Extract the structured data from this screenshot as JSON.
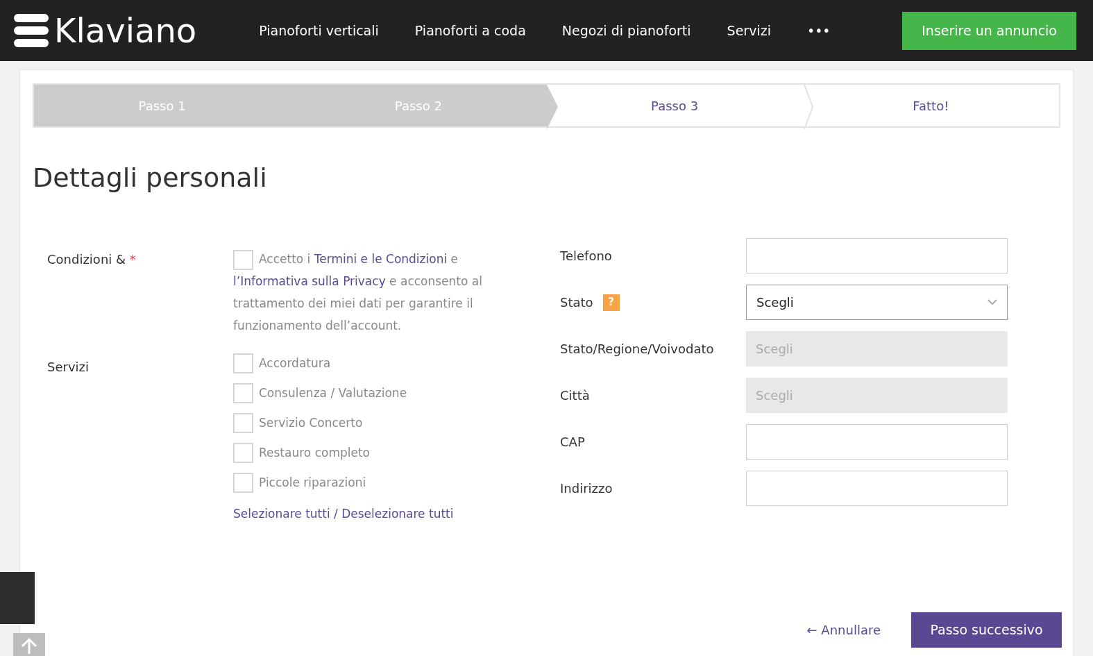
{
  "header": {
    "logo": "Klaviano",
    "nav": [
      "Pianoforti verticali",
      "Pianoforti a coda",
      "Negozi di pianoforti",
      "Servizi",
      "•••"
    ],
    "cta": "Inserire un annuncio"
  },
  "steps": [
    {
      "label": "Passo 1",
      "done": true
    },
    {
      "label": "Passo 2",
      "done": true
    },
    {
      "label": "Passo 3",
      "done": false
    },
    {
      "label": "Fatto!",
      "done": false
    }
  ],
  "title": "Dettagli personali",
  "terms": {
    "label": "Condizioni &",
    "required_mark": "*",
    "checked": false,
    "segments": [
      {
        "kind": "text",
        "text": "Accetto i "
      },
      {
        "kind": "link",
        "text": "Termini e le Condizioni"
      },
      {
        "kind": "text",
        "text": " e "
      },
      {
        "kind": "link",
        "text": "l’Informativa sulla Privacy"
      },
      {
        "kind": "text",
        "text": " e acconsento al trattamento dei miei dati per garantire il funzionamento dell’account."
      }
    ]
  },
  "services": {
    "label": "Servizi",
    "options": [
      {
        "label": "Accordatura",
        "checked": false
      },
      {
        "label": "Consulenza / Valutazione",
        "checked": false
      },
      {
        "label": "Servizio Concerto",
        "checked": false
      },
      {
        "label": "Restauro completo",
        "checked": false
      },
      {
        "label": "Piccole riparazioni",
        "checked": false
      }
    ],
    "select_all": "Selezionare tutti",
    "separator": "/",
    "deselect_all": "Deselezionare tutti"
  },
  "fields": [
    {
      "label": "Telefono",
      "kind": "text"
    },
    {
      "label": "Stato",
      "kind": "select",
      "help": "?",
      "value": "Scegli"
    },
    {
      "label": "Stato/Regione/Voivodato",
      "kind": "select",
      "disabled": true,
      "value": "Scegli"
    },
    {
      "label": "Città",
      "kind": "select",
      "disabled": true,
      "value": "Scegli"
    },
    {
      "label": "CAP",
      "kind": "text"
    },
    {
      "label": "Indirizzo",
      "kind": "text"
    }
  ],
  "actions": {
    "cancel": "← Annullare",
    "next": "Passo successivo"
  }
}
